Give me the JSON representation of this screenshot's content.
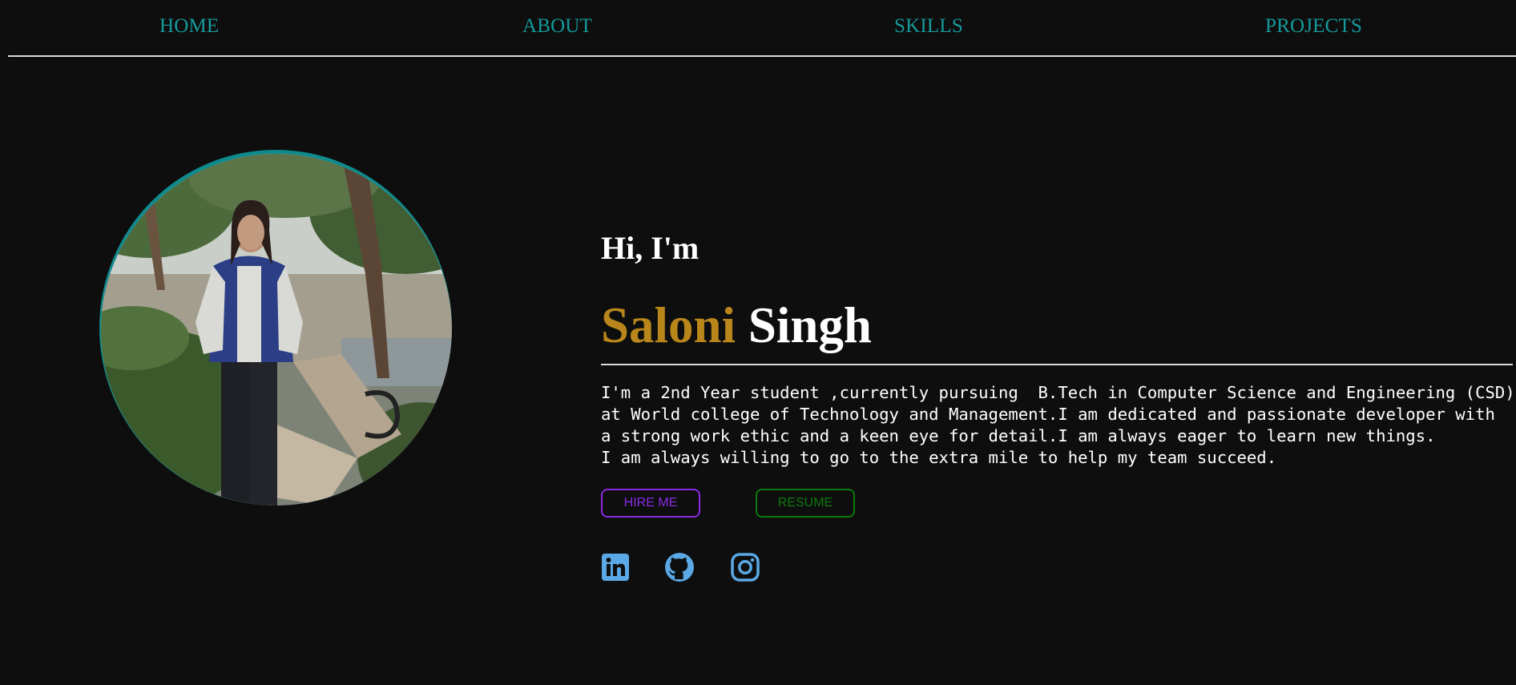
{
  "nav": {
    "items": [
      {
        "label": "HOME"
      },
      {
        "label": "ABOUT"
      },
      {
        "label": "SKILLS"
      },
      {
        "label": "PROJECTS"
      }
    ]
  },
  "hero": {
    "greeting": "Hi, I'm",
    "first_name": "Saloni",
    "last_name": "Singh",
    "bio_lines": [
      "I'm a 2nd Year student ,currently pursuing  B.Tech in Computer Science and Engineering (CSD)",
      "at World college of Technology and Management.I am dedicated and passionate developer with",
      "a strong work ethic and a keen eye for detail.I am always eager to learn new things.",
      "I am always willing to go to the extra mile to help my team succeed."
    ],
    "buttons": {
      "hire_label": "HIRE ME",
      "resume_label": "RESUME"
    },
    "social": [
      {
        "icon": "linkedin-icon"
      },
      {
        "icon": "github-icon"
      },
      {
        "icon": "instagram-icon"
      }
    ]
  },
  "colors": {
    "background": "#0e0e0e",
    "nav_link": "#159a9c",
    "photo_ring": "#0f8b8d",
    "first_name": "#b8861b",
    "hire_button": "#8a2be2",
    "resume_button": "#0d7a0d",
    "social_icons": "#5aa9e6"
  }
}
